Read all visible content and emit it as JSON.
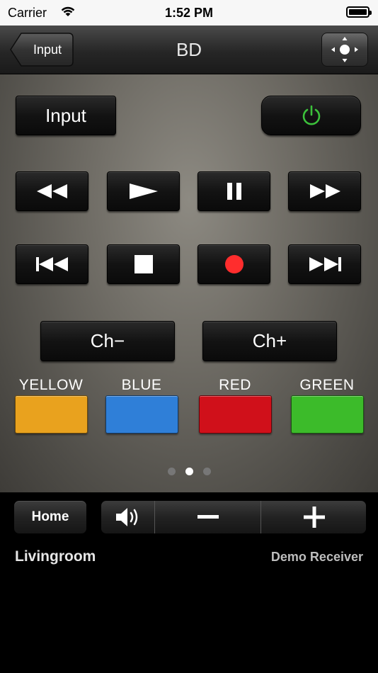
{
  "status_bar": {
    "carrier": "Carrier",
    "time": "1:52 PM"
  },
  "nav": {
    "back_label": "Input",
    "title": "BD"
  },
  "remote": {
    "input_label": "Input",
    "channel_down_label": "Ch−",
    "channel_up_label": "Ch+",
    "color_buttons": [
      {
        "label": "YELLOW",
        "color": "#e9a21e"
      },
      {
        "label": "BLUE",
        "color": "#2f7fd8"
      },
      {
        "label": "RED",
        "color": "#d0101a"
      },
      {
        "label": "GREEN",
        "color": "#3cbb2a"
      }
    ],
    "power_color": "#3cc13b",
    "record_color": "#ff2d2d"
  },
  "pager": {
    "pages": 3,
    "current": 2
  },
  "bottom": {
    "home_label": "Home",
    "room": "Livingroom",
    "device": "Demo Receiver"
  }
}
